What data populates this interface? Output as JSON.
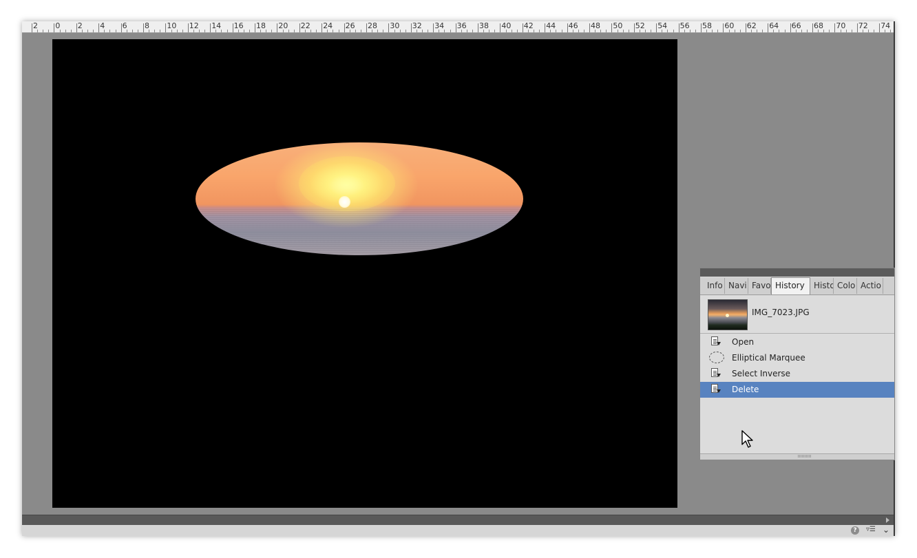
{
  "ruler": {
    "labels": [
      "2",
      "0",
      "2",
      "4",
      "6",
      "8",
      "10",
      "12",
      "14",
      "16",
      "18",
      "20",
      "22",
      "24",
      "26",
      "28",
      "30",
      "32",
      "34",
      "36",
      "38",
      "40",
      "42",
      "44",
      "46",
      "48",
      "50",
      "52",
      "54",
      "56",
      "58",
      "60",
      "62",
      "64",
      "66",
      "68",
      "70",
      "72",
      "74"
    ]
  },
  "document": {
    "file_name": "IMG_7023.JPG"
  },
  "panel": {
    "tabs": [
      {
        "label": "Info",
        "active": false
      },
      {
        "label": "Navi",
        "active": false
      },
      {
        "label": "Favo",
        "active": false
      },
      {
        "label": "History",
        "active": true
      },
      {
        "label": "Histo",
        "active": false
      },
      {
        "label": "Colo",
        "active": false
      },
      {
        "label": "Actio",
        "active": false
      }
    ],
    "snapshot_label": "IMG_7023.JPG",
    "states": [
      {
        "label": "Open",
        "icon": "document-icon",
        "selected": false
      },
      {
        "label": "Elliptical Marquee",
        "icon": "elliptical-marquee-icon",
        "selected": false
      },
      {
        "label": "Select Inverse",
        "icon": "document-icon",
        "selected": false
      },
      {
        "label": "Delete",
        "icon": "document-icon",
        "selected": true
      }
    ]
  },
  "statusbar": {
    "help_symbol": "?",
    "menu_symbol": "▿☰",
    "chevron_symbol": "⌄"
  },
  "colors": {
    "workspace": "#8a8a8a",
    "selection": "#5883c0",
    "canvas": "#000000"
  }
}
